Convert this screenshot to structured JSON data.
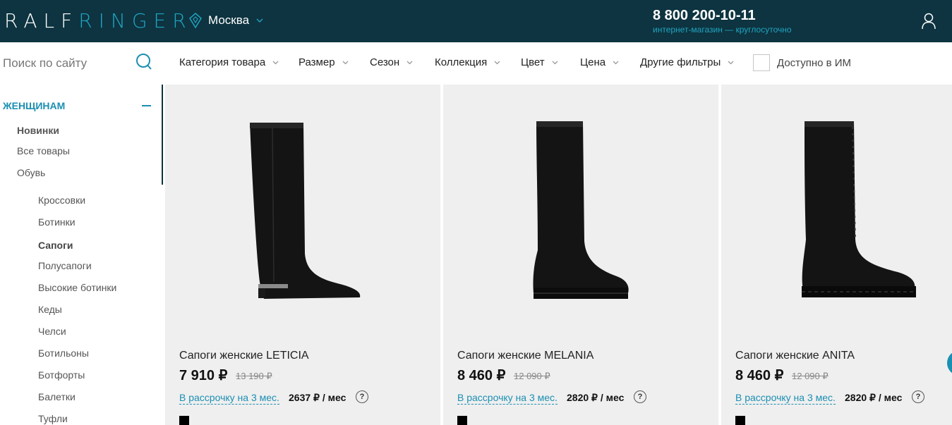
{
  "header": {
    "logo": {
      "part1": "RALF",
      "part2": "RINGER"
    },
    "city": "Москва",
    "phone": "8 800 200-10-11",
    "phone_note": "интернет-магазин — круглосуточно"
  },
  "filters": {
    "search_placeholder": "Поиск по сайту",
    "items": [
      "Категория товара",
      "Размер",
      "Сезон",
      "Коллекция",
      "Цвет",
      "Цена",
      "Другие фильтры"
    ],
    "available_label": "Доступно в ИМ"
  },
  "sidebar": {
    "section": "ЖЕНЩИНАМ",
    "top_items": [
      "Новинки",
      "Все товары",
      "Обувь"
    ],
    "sub_items": [
      "Кроссовки",
      "Ботинки",
      "Сапоги",
      "Полусапоги",
      "Высокие ботинки",
      "Кеды",
      "Челси",
      "Ботильоны",
      "Ботфорты",
      "Балетки",
      "Туфли"
    ]
  },
  "products": [
    {
      "name": "Сапоги женские LETICIA",
      "price": "7 910 ₽",
      "old_price": "13 190 ₽",
      "installment": "В рассрочку на 3 мес.",
      "monthly": "2637 ₽ / мес",
      "help": "?"
    },
    {
      "name": "Сапоги женские MELANIA",
      "price": "8 460 ₽",
      "old_price": "12 090 ₽",
      "installment": "В рассрочку на 3 мес.",
      "monthly": "2820 ₽ / мес",
      "help": "?"
    },
    {
      "name": "Сапоги женские ANITA",
      "price": "8 460 ₽",
      "old_price": "12 090 ₽",
      "installment": "В рассрочку на 3 мес.",
      "monthly": "2820 ₽ / мес",
      "help": "?"
    }
  ],
  "colors": {
    "header_bg": "#0d3440",
    "accent": "#1b8fb3",
    "card_bg": "#efefef"
  }
}
